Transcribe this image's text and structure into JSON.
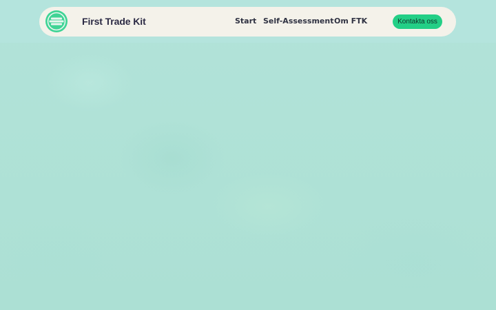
{
  "header": {
    "brand_name": "First Trade Kit",
    "logo_icon": "ftk-logo-icon",
    "nav": [
      {
        "label": "Start"
      },
      {
        "label": "Self-Assessment"
      },
      {
        "label": "Om FTK"
      }
    ],
    "cta_label": "Kontakta oss"
  },
  "colors": {
    "background": "#ace0d5",
    "navbar": "#f4f2ea",
    "accent": "#23cf86",
    "text_dark": "#2b2a44"
  }
}
